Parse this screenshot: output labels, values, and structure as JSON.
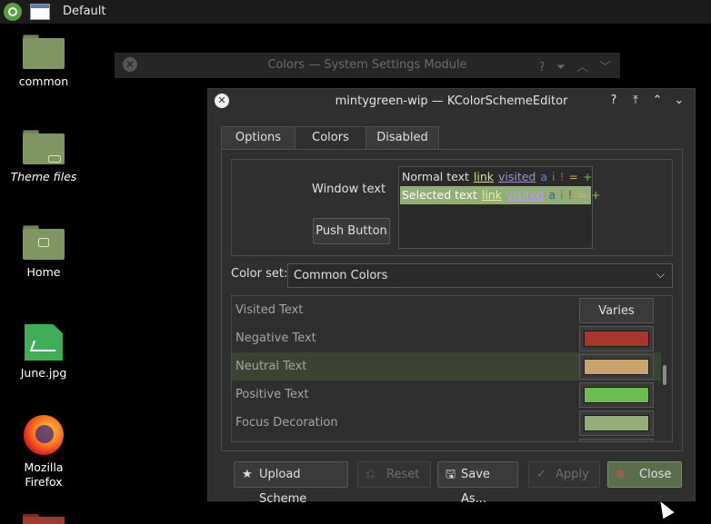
{
  "panel": {
    "desktop_label": "Default"
  },
  "desktop_icons": [
    {
      "label": "common"
    },
    {
      "label": "Theme files"
    },
    {
      "label": "Home"
    },
    {
      "label": "June.jpg"
    },
    {
      "label": "Mozilla Firefox"
    }
  ],
  "bg_window": {
    "title": "Colors — System Settings Module"
  },
  "dialog": {
    "title": "mintygreen-wip — KColorSchemeEditor",
    "tabs": [
      {
        "label": "Options"
      },
      {
        "label": "Colors"
      },
      {
        "label": "Disabled"
      }
    ],
    "preview": {
      "window_text": "Window text",
      "push_button": "Push Button",
      "normal_row": {
        "text": "Normal text",
        "link": "link",
        "visited": "visited",
        "a": "a",
        "i": "i",
        "bang": "!",
        "eq": "=",
        "plus": "+"
      },
      "selected_row": {
        "text": "Selected text",
        "link": "link",
        "visited": "visited",
        "a": "a",
        "i": "i",
        "bang": "!",
        "eq": "=",
        "plus": "+"
      }
    },
    "color_set": {
      "label": "Color set:",
      "value": "Common Colors"
    },
    "color_rows": [
      {
        "name": "Visited Text",
        "value": "Varies",
        "color": ""
      },
      {
        "name": "Negative Text",
        "value": "",
        "color": "#a8362e"
      },
      {
        "name": "Neutral Text",
        "value": "",
        "color": "#c8a56a"
      },
      {
        "name": "Positive Text",
        "value": "",
        "color": "#6cbd4e"
      },
      {
        "name": "Focus Decoration",
        "value": "",
        "color": "#93ae76"
      }
    ],
    "buttons": {
      "upload": "Upload Scheme",
      "reset": "Reset",
      "save_as": "Save As...",
      "apply": "Apply",
      "close": "Close"
    }
  },
  "colors": {
    "accent": "#93ae76",
    "selection": "#93ae76",
    "link": "#d6e38a",
    "visited": "#a38fd3",
    "negative": "#a8362e",
    "neutral": "#c8a56a",
    "positive": "#6cbd4e"
  }
}
